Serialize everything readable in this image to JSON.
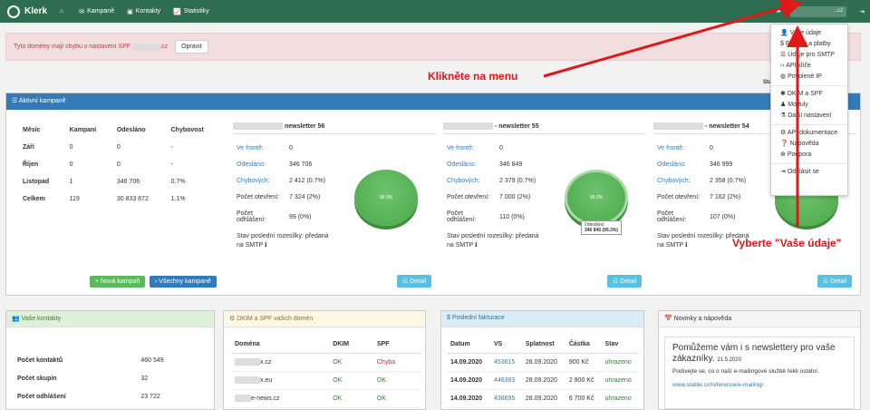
{
  "nav": {
    "brand": "Klerk",
    "items": [
      {
        "icon": "home-icon",
        "label": ""
      },
      {
        "icon": "envelope-icon",
        "label": "Kampaně"
      },
      {
        "icon": "contacts-icon",
        "label": "Kontakty"
      },
      {
        "icon": "chart-icon",
        "label": "Statistiky"
      }
    ],
    "user": "...cz"
  },
  "alert": {
    "text_pre": "Tyto domény mají chybu v nastavení SPF",
    "text_post": ".cz",
    "button": "Opravit"
  },
  "stat_label": "Sta",
  "active": {
    "title": "Aktivní kampaně",
    "headers": [
      "Měsíc",
      "Kampaní",
      "Odesláno",
      "Chybovost"
    ],
    "rows": [
      [
        "Září",
        "0",
        "0",
        "-"
      ],
      [
        "Říjen",
        "0",
        "0",
        "-"
      ],
      [
        "Listopad",
        "1",
        "346 706",
        "0.7%"
      ],
      [
        "Celkem",
        "119",
        "30 833 872",
        "1.1%"
      ]
    ],
    "new_btn": "+ Nová kampaň",
    "all_btn": "› Všechny kampaně"
  },
  "campaigns": [
    {
      "title": "newsletter 56",
      "rows": [
        [
          "Ve frontě:",
          "0"
        ],
        [
          "Odesláno:",
          "346 706"
        ],
        [
          "Chybových:",
          "2 412 (0.7%)"
        ],
        [
          "Počet otevření:",
          "7 324 (2%)"
        ],
        [
          "Počet odhlášení:",
          "99 (0%)"
        ]
      ],
      "stav": "Stav poslední rozesílky: předaná na SMTP ℹ",
      "pie": "99.3%",
      "detail": "Detail"
    },
    {
      "title": "- newsletter 55",
      "rows": [
        [
          "Ve frontě:",
          "0"
        ],
        [
          "Odesláno:",
          "346 849"
        ],
        [
          "Chybových:",
          "2 379 (0.7%)"
        ],
        [
          "Počet otevření:",
          "7 000 (2%)"
        ],
        [
          "Počet odhlášení:",
          "110 (0%)"
        ]
      ],
      "stav": "Stav poslední rozesílky: předaná na SMTP ℹ",
      "pie": "99.3%",
      "tooltip1": "Odesláno",
      "tooltip2": "346 849 (99.3%)",
      "detail": "Detail"
    },
    {
      "title": "- newsletter 54",
      "rows": [
        [
          "Ve frontě:",
          "0"
        ],
        [
          "Odesláno:",
          "346 999"
        ],
        [
          "Chybových:",
          "2 358 (0.7%)"
        ],
        [
          "Počet otevření:",
          "7 162 (2%)"
        ],
        [
          "Počet odhlášení:",
          "107 (0%)"
        ]
      ],
      "stav": "Stav poslední rozesílky: předaná na SMTP ℹ",
      "detail": "Detail"
    }
  ],
  "menu": {
    "items": [
      "Vaše údaje",
      "Faktury a platby",
      "Údaje pro SMTP",
      "API klíče",
      "Povolené IP",
      "DKIM a SPF",
      "Moduly",
      "Další nastavení",
      "API dokumentace",
      "Nápověda",
      "Podpora",
      "Odhlásit se"
    ]
  },
  "annotations": {
    "menu": "Klikněte na menu",
    "vase": "Vyberte \"Vaše údaje\""
  },
  "contacts": {
    "title": "Vaše kontakty",
    "rows": [
      [
        "Počet kontaktů",
        "460 549"
      ],
      [
        "Počet skupin",
        "32"
      ],
      [
        "Počet odhlášení",
        "23 722"
      ]
    ]
  },
  "dkim": {
    "title": "DKIM a SPF vašich domén",
    "headers": [
      "Doména",
      "DKIM",
      "SPF"
    ],
    "rows": [
      [
        "x.cz",
        "OK",
        "Chyba"
      ],
      [
        "x.eu",
        "OK",
        "OK"
      ],
      [
        "e-news.cz",
        "OK",
        "OK"
      ]
    ]
  },
  "invoices": {
    "title": "Poslední fakturace",
    "headers": [
      "Datum",
      "VS",
      "Splatnost",
      "Částka",
      "Stav"
    ],
    "rows": [
      [
        "14.09.2020",
        "453615",
        "28.09.2020",
        "900 Kč",
        "uhrazeno"
      ],
      [
        "14.09.2020",
        "446383",
        "28.09.2020",
        "2 900 Kč",
        "uhrazeno"
      ],
      [
        "14.09.2020",
        "438695",
        "28.09.2020",
        "6 700 Kč",
        "uhrazeno"
      ]
    ]
  },
  "news": {
    "title": "Novinky a nápověda",
    "heading": "Pomůžeme vám i s newslettery pro vaše zákazníky.",
    "date": "21.5.2020",
    "text": "Podívejte se, co o naší e-mailingové službě řekli ostatní.",
    "link": "www.stable.cz/reference/e-mailing/"
  }
}
